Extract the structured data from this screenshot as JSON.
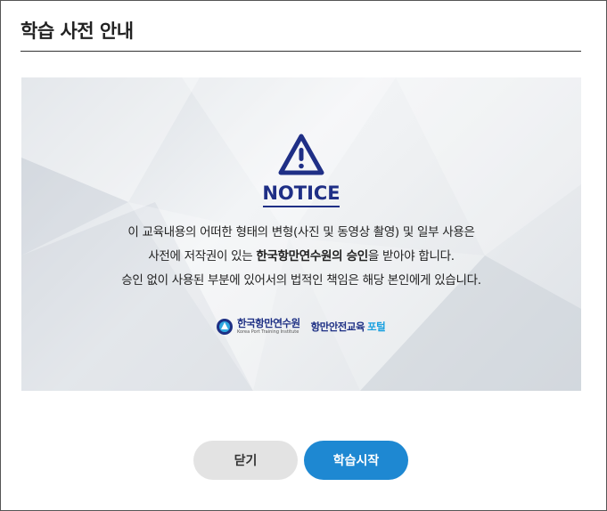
{
  "dialog": {
    "title": "학습 사전 안내"
  },
  "notice": {
    "heading": "NOTICE",
    "line1": "이 교육내용의 어떠한 형태의 변형(사진 및 동영상 촬영) 및 일부 사용은",
    "line2_pre": "사전에 저작권이 있는 ",
    "line2_bold": "한국항만연수원의 승인",
    "line2_post": "을 받아야 합니다.",
    "line3": "승인 없이 사용된 부분에 있어서의 법적인 책임은 해당 본인에게 있습니다.",
    "icon": "warning-triangle-icon",
    "accent_color": "#1f2f86"
  },
  "logos": {
    "org_name": "한국항만연수원",
    "org_name_en": "Korea Port Training Institute",
    "portal_name": "항만안전교육",
    "portal_suffix": "포털"
  },
  "buttons": {
    "close_label": "닫기",
    "start_label": "학습시작",
    "start_color": "#1e88d2"
  }
}
